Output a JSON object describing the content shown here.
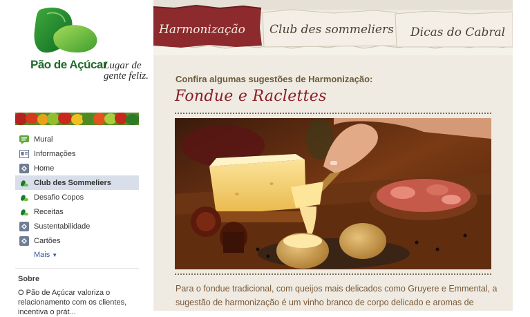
{
  "brand": {
    "name": "Pão de Açúcar",
    "slogan": "Lugar de gente feliz.",
    "colors": {
      "leaf_dark": "#1a7a2e",
      "leaf_light": "#5fbf3a",
      "text_green": "#1f6b2a"
    }
  },
  "sidebar": {
    "items": [
      {
        "label": "Mural",
        "icon": "wall-icon"
      },
      {
        "label": "Informações",
        "icon": "info-icon"
      },
      {
        "label": "Home",
        "icon": "app-icon"
      },
      {
        "label": "Club des Sommeliers",
        "icon": "pao-de-acucar-icon",
        "active": true
      },
      {
        "label": "Desafio Copos",
        "icon": "pao-de-acucar-icon"
      },
      {
        "label": "Receitas",
        "icon": "pao-de-acucar-icon"
      },
      {
        "label": "Sustentabilidade",
        "icon": "app-icon"
      },
      {
        "label": "Cartões",
        "icon": "app-icon"
      }
    ],
    "more_label": "Mais",
    "about": {
      "title": "Sobre",
      "text": "O Pão de Açúcar valoriza o relacionamento com os clientes, incentiva o prát..."
    },
    "active_bg": "#d8dfea"
  },
  "tabs": [
    {
      "label": "Harmonização",
      "active": true
    },
    {
      "label": "Club des sommeliers",
      "active": false
    },
    {
      "label": "Dicas do Cabral",
      "active": false
    }
  ],
  "content": {
    "subtitle": "Confira algumas sugestões de Harmonização:",
    "heading": "Fondue e Raclettes",
    "body": "Para o fondue tradicional, com queijos mais delicados como Gruyere e Emmental, a sugestão de harmonização é um vinho branco de corpo delicado e aromas de",
    "accent_color": "#8a1e28"
  }
}
